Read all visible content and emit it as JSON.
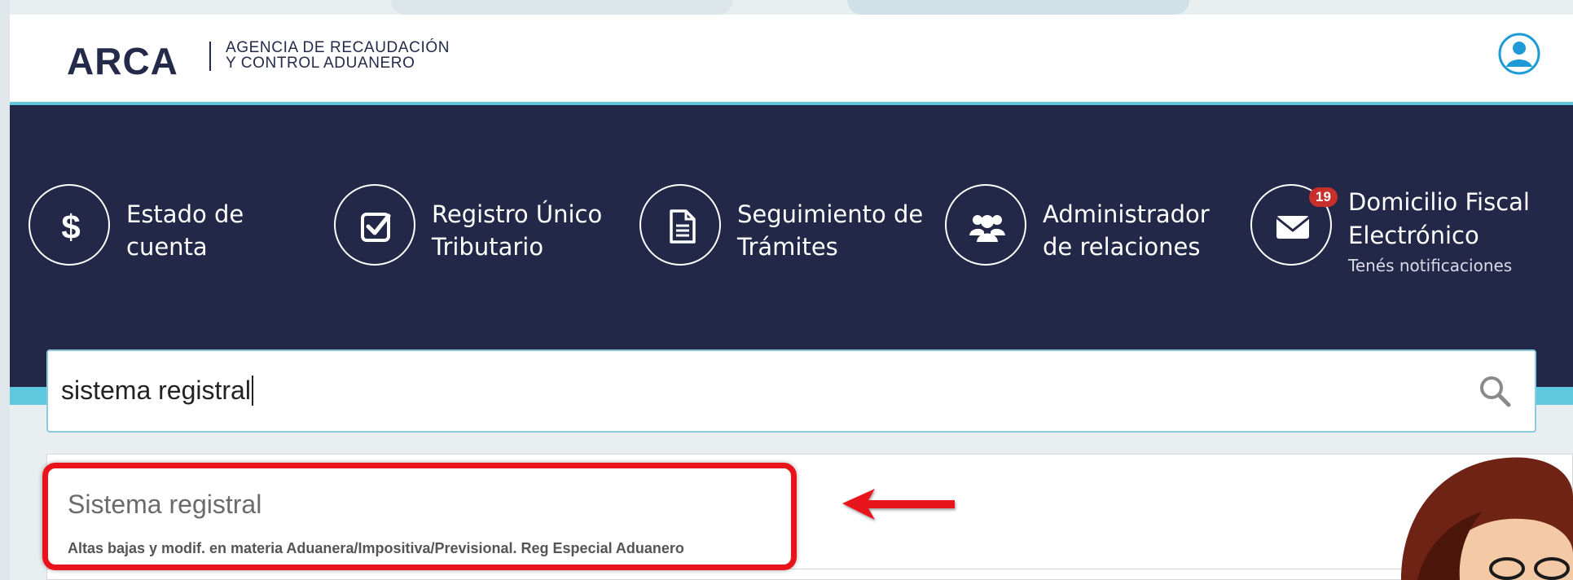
{
  "header": {
    "logo": "ARCA",
    "agency_line1": "AGENCIA DE RECAUDACIÓN",
    "agency_line2": "Y CONTROL ADUANERO",
    "user_icon": "user-circle-icon"
  },
  "nav": {
    "tiles": [
      {
        "line1": "Estado de",
        "line2": "cuenta",
        "icon": "dollar-icon"
      },
      {
        "line1": "Registro Único",
        "line2": "Tributario",
        "icon": "checkbox-icon"
      },
      {
        "line1": "Seguimiento de",
        "line2": "Trámites",
        "icon": "document-icon"
      },
      {
        "line1": "Administrador",
        "line2": "de relaciones",
        "icon": "users-icon"
      },
      {
        "line1": "Domicilio Fiscal",
        "line2": "Electrónico",
        "sub": "Tenés notificaciones",
        "badge": "19",
        "icon": "envelope-icon"
      }
    ]
  },
  "search": {
    "value": "sistema registral",
    "icon": "search-icon"
  },
  "results": [
    {
      "title": "Sistema registral",
      "description": "Altas bajas y modif. en materia Aduanera/Impositiva/Previsional. Reg Especial Aduanero"
    }
  ],
  "colors": {
    "navy": "#242848",
    "accent": "#5ec8de",
    "highlight": "#e8131b",
    "badge": "#c9302c"
  }
}
